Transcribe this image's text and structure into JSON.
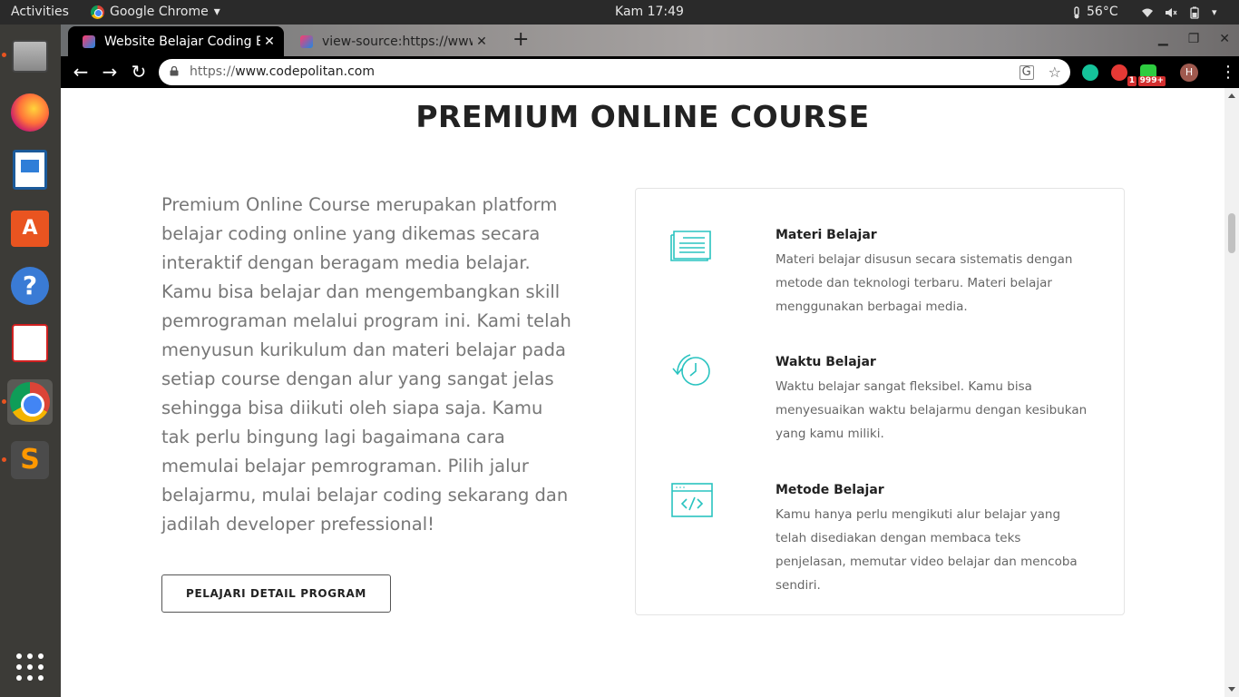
{
  "topbar": {
    "activities": "Activities",
    "app_name": "Google Chrome",
    "app_menu_arrow": "▾",
    "clock": "Kam 17:49",
    "temperature": "56°C"
  },
  "browser": {
    "tabs": [
      {
        "title": "Website Belajar Coding B",
        "close": "✕"
      },
      {
        "title": "view-source:https://www",
        "close": "✕"
      }
    ],
    "new_tab": "+",
    "url_prefix": "https://",
    "url_host": "www.codepolitan.com",
    "extension_badges": [
      "1",
      "999+"
    ],
    "avatar_letter": "H",
    "colors": {
      "toolbar": "#000000",
      "accent": "#29c3c0"
    }
  },
  "page": {
    "section_title": "PREMIUM ONLINE COURSE",
    "intro": "Premium Online Course merupakan platform belajar coding online yang dikemas secara interaktif dengan beragam media belajar. Kamu bisa belajar dan mengembangkan skill pemrograman melalui program ini. Kami telah menyusun kurikulum dan materi belajar pada setiap course dengan alur yang sangat jelas sehingga bisa diikuti oleh siapa saja. Kamu tak perlu bingung lagi bagaimana cara memulai belajar pemrograman. Pilih jalur belajarmu, mulai belajar coding sekarang dan jadilah developer prefessional!",
    "cta": "PELAJARI DETAIL PROGRAM",
    "features": [
      {
        "icon": "document-lines-icon",
        "title": "Materi Belajar",
        "desc": "Materi belajar disusun secara sistematis dengan metode dan teknologi terbaru. Materi belajar menggunakan berbagai media."
      },
      {
        "icon": "clock-refresh-icon",
        "title": "Waktu Belajar",
        "desc": "Waktu belajar sangat fleksibel. Kamu bisa menyesuaikan waktu belajarmu dengan kesibukan yang kamu miliki."
      },
      {
        "icon": "code-window-icon",
        "title": "Metode Belajar",
        "desc": "Kamu hanya perlu mengikuti alur belajar yang telah disediakan dengan membaca teks penjelasan, memutar video belajar dan mencoba sendiri."
      }
    ]
  },
  "dock": {
    "apps": [
      "files-icon",
      "firefox-icon",
      "libreoffice-writer-icon",
      "software-center-icon",
      "help-icon",
      "document-viewer-icon",
      "chrome-icon",
      "sublime-text-icon"
    ],
    "show_apps": "show-applications-icon"
  }
}
